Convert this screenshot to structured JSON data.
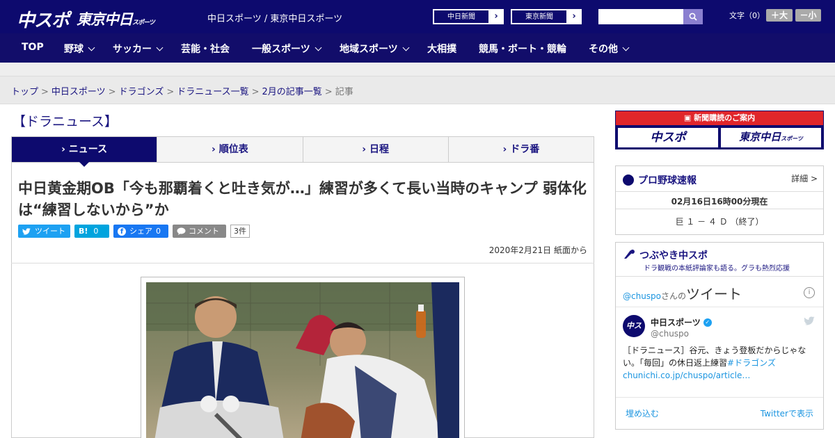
{
  "header": {
    "logo_chuspo": "中スポ",
    "logo_tokyo": "東京中日",
    "logo_tokyo_small": "スポーツ",
    "site_names": "中日スポーツ / 東京中日スポーツ",
    "chunichi_btn": "中日新聞",
    "tokyo_btn": "東京新聞",
    "arrow": "›",
    "search_placeholder": "",
    "fontsize_label": "文字（0）",
    "font_plus": "＋大",
    "font_minus": "－小"
  },
  "nav": {
    "items": [
      {
        "label": "TOP"
      },
      {
        "label": "野球"
      },
      {
        "label": "サッカー"
      },
      {
        "label": "芸能・社会"
      },
      {
        "label": "一般スポーツ"
      },
      {
        "label": "地域スポーツ"
      },
      {
        "label": "大相撲"
      },
      {
        "label": "競馬・ボート・競輪"
      },
      {
        "label": "その他"
      }
    ]
  },
  "breadcrumb": {
    "items": [
      "トップ",
      "中日スポーツ",
      "ドラゴンズ",
      "ドラニュース一覧",
      "2月の記事一覧"
    ],
    "current": "記事",
    "sep": ">"
  },
  "section": {
    "title": "【ドラニュース】"
  },
  "tabs": [
    "ニュース",
    "順位表",
    "日程",
    "ドラ番"
  ],
  "article": {
    "headline": "中日黄金期OB「今も那覇着くと吐き気が…」練習が多くて長い当時のキャンプ 弱体化は“練習しないから”か",
    "tweet": "ツイート",
    "hatena": "B!",
    "hatena_count": "0",
    "facebook": "シェア",
    "facebook_count": "0",
    "comment": "コメント",
    "comment_count": "3件",
    "date": "2020年2月21日 紙面から"
  },
  "sidebar": {
    "subscribe_title": "新聞購読のご案内",
    "subscribe_chuspo": "中スポ",
    "subscribe_tokyo": "東京中日",
    "subscribe_tokyo_small": "スポーツ",
    "baseball_title": "プロ野球速報",
    "baseball_detail": "詳細 >",
    "baseball_time": "02月16日16時00分現在",
    "baseball_score": "巨 １ － ４ Ｄ （終了）",
    "tsubu_title": "つぶやき中スポ",
    "tsubu_sub": "ドラ観戦の本紙評論家も語る。グラも熱烈応援",
    "tweets_handle": "@chuspo",
    "tweets_san": "さんの",
    "tweets_word": "ツイート",
    "tw_name": "中日スポーツ",
    "tw_handle": "@chuspo",
    "tw_text": "［ドラニュース］谷元、きょう登板だからじゃない。「毎回」の休日返上練習",
    "tw_hashtag": "#ドラゴンズ",
    "tw_link": "chunichi.co.jp/chuspo/article…",
    "embed": "埋め込む",
    "view_on_twitter": "Twitterで表示"
  },
  "colors": {
    "navy": "#0d0a6e",
    "twitter": "#1da1f2",
    "hatena": "#00a4de",
    "facebook": "#1877f2",
    "comment": "#888888",
    "red": "#e0262b"
  }
}
